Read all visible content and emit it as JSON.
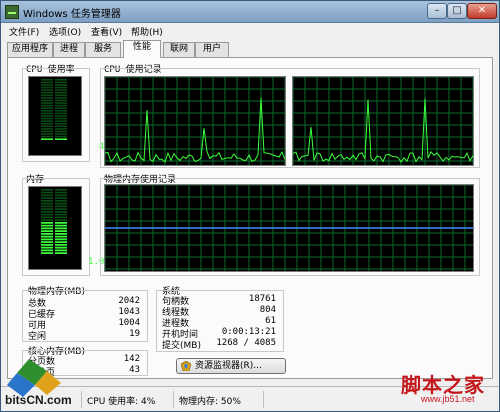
{
  "window": {
    "title": "Windows 任务管理器"
  },
  "menubar": {
    "items": [
      "文件(F)",
      "选项(O)",
      "查看(V)",
      "帮助(H)"
    ]
  },
  "tabs": [
    "应用程序",
    "进程",
    "服务",
    "性能",
    "联网",
    "用户"
  ],
  "active_tab": "性能",
  "cpu": {
    "usage_label": "CPU 使用率",
    "usage_value": "4 %",
    "usage_fraction": 0.04,
    "history_label": "CPU 使用记录"
  },
  "memory": {
    "label": "内存",
    "value": "1.01 GB",
    "usage_fraction": 0.5,
    "history_label": "物理内存使用记录"
  },
  "physical_memory": {
    "title": "物理内存(MB)",
    "rows": [
      {
        "label": "总数",
        "value": "2042"
      },
      {
        "label": "已缓存",
        "value": "1043"
      },
      {
        "label": "可用",
        "value": "1004"
      },
      {
        "label": "空闲",
        "value": "19"
      }
    ]
  },
  "kernel_memory": {
    "title": "核心内存(MB)",
    "rows": [
      {
        "label": "分页数",
        "value": "142"
      },
      {
        "label": "未分页",
        "value": "43"
      }
    ]
  },
  "system": {
    "title": "系统",
    "rows": [
      {
        "label": "句柄数",
        "value": "18761"
      },
      {
        "label": "线程数",
        "value": "804"
      },
      {
        "label": "进程数",
        "value": "61"
      },
      {
        "label": "开机时间",
        "value": "0:00:13:21"
      },
      {
        "label": "提交(MB)",
        "value": "1268 / 4085"
      }
    ]
  },
  "resource_monitor_button": "资源监视器(R)...",
  "statusbar": {
    "cpu": "CPU 使用率: 4%",
    "memory": "物理内存: 50%"
  },
  "watermarks": {
    "left": "bitsCN.com",
    "right_main": "脚本之家",
    "right_sub": "www.jb51.net"
  },
  "colors": {
    "graph_green": "#3cff3c",
    "graph_grid": "#0b6b2a",
    "memory_line": "#4a8cff",
    "brand_red": "#c4171c"
  },
  "icons": {
    "app": "task-manager-icon",
    "resmon": "resource-monitor-icon"
  }
}
